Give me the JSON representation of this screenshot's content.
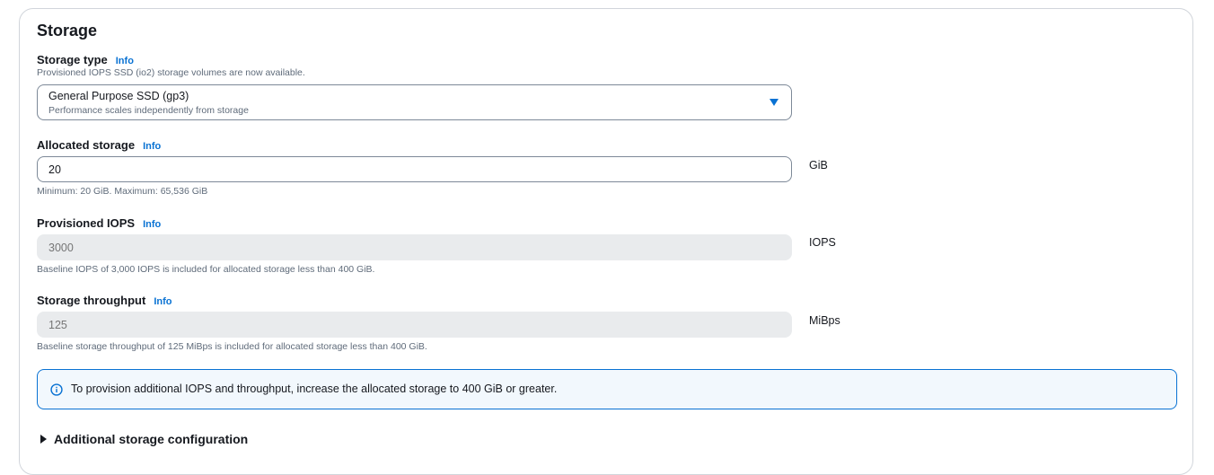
{
  "section": {
    "title": "Storage"
  },
  "storage_type": {
    "label": "Storage type",
    "info": "Info",
    "description": "Provisioned IOPS SSD (io2) storage volumes are now available.",
    "selected_value": "General Purpose SSD (gp3)",
    "selected_description": "Performance scales independently from storage"
  },
  "allocated_storage": {
    "label": "Allocated storage",
    "info": "Info",
    "value": "20",
    "unit": "GiB",
    "constraint": "Minimum: 20 GiB. Maximum: 65,536 GiB"
  },
  "provisioned_iops": {
    "label": "Provisioned IOPS",
    "info": "Info",
    "placeholder": "3000",
    "unit": "IOPS",
    "description": "Baseline IOPS of 3,000 IOPS is included for allocated storage less than 400 GiB."
  },
  "storage_throughput": {
    "label": "Storage throughput",
    "info": "Info",
    "placeholder": "125",
    "unit": "MiBps",
    "description": "Baseline storage throughput of 125 MiBps is included for allocated storage less than 400 GiB."
  },
  "alert": {
    "text": "To provision additional IOPS and throughput, increase the allocated storage to 400 GiB or greater.",
    "icon": "info-circle-icon",
    "color": "#0972d3"
  },
  "additional_config": {
    "label": "Additional storage configuration"
  },
  "colors": {
    "accent": "#0972d3",
    "disabled_bg": "#e9ebed",
    "text": "#16191f",
    "muted": "#5f6b7a"
  }
}
